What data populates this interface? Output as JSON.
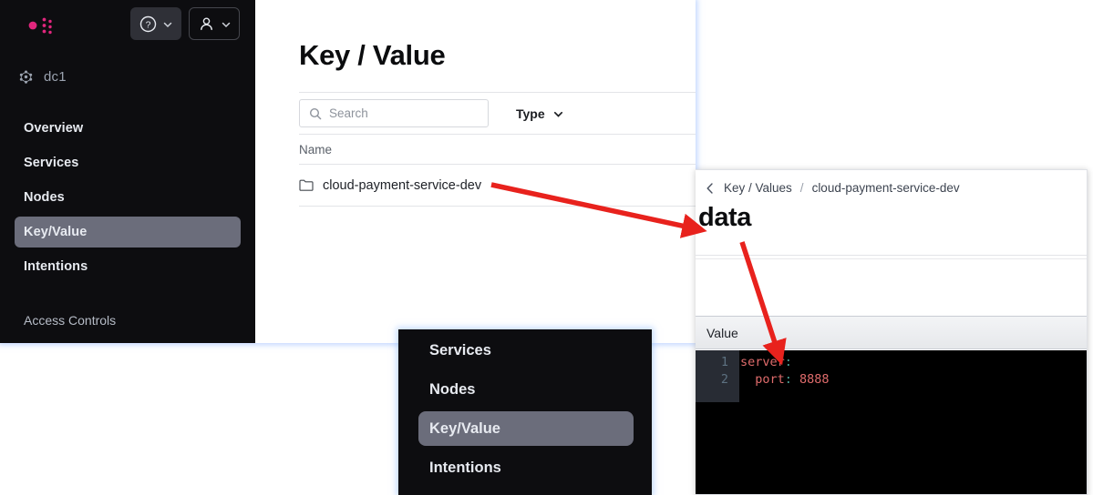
{
  "app": {
    "logo_icon": "consul-logo-icon",
    "help_button": {
      "icon": "question-circle-icon",
      "chevron": "chevron-down-icon"
    },
    "user_button": {
      "icon": "user-icon",
      "chevron": "chevron-down-icon"
    },
    "datacenter": {
      "icon": "nodes-icon",
      "label": "dc1"
    }
  },
  "sidebar": {
    "items": [
      {
        "label": "Overview",
        "active": false
      },
      {
        "label": "Services",
        "active": false
      },
      {
        "label": "Nodes",
        "active": false
      },
      {
        "label": "Key/Value",
        "active": true
      },
      {
        "label": "Intentions",
        "active": false
      }
    ],
    "footer": "Access Controls"
  },
  "main": {
    "title": "Key / Value",
    "search": {
      "icon": "search-icon",
      "placeholder": "Search",
      "value": ""
    },
    "type_filter": {
      "label": "Type",
      "chevron": "chevron-down-icon"
    },
    "columns": [
      "Name"
    ],
    "rows": [
      {
        "icon": "folder-icon",
        "name": "cloud-payment-service-dev"
      }
    ]
  },
  "zoom_nav": {
    "items": [
      {
        "label": "Services",
        "active": false
      },
      {
        "label": "Nodes",
        "active": false
      },
      {
        "label": "Key/Value",
        "active": true
      },
      {
        "label": "Intentions",
        "active": false
      }
    ]
  },
  "detail": {
    "back_icon": "chevron-left-icon",
    "breadcrumb": {
      "root": "Key / Values",
      "separator": "/",
      "current": "cloud-payment-service-dev"
    },
    "title": "data",
    "value_column": "Value",
    "editor": {
      "lines": [
        {
          "no": "1",
          "key": "server",
          "colon": ":",
          "value": ""
        },
        {
          "no": "2",
          "key": "  port",
          "colon": ":",
          "value": " 8888"
        }
      ]
    }
  },
  "colors": {
    "brand_pink": "#e0267d",
    "sidebar_bg": "#0d0d10",
    "nav_active": "#6b6d7b",
    "annotation_red": "#e8221d",
    "code_red": "#e06c6c",
    "code_teal": "#4aa79a",
    "glow_blue": "#8cb4ff"
  }
}
